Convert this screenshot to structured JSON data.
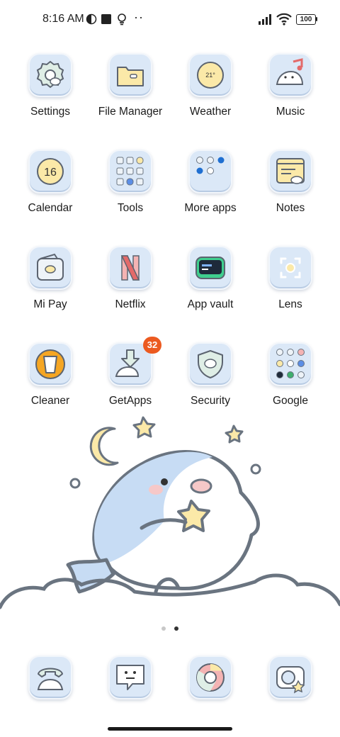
{
  "status_bar": {
    "time": "8:16 AM",
    "battery": "100",
    "more": "··"
  },
  "apps": [
    {
      "label": "Settings",
      "icon": "gear-icon"
    },
    {
      "label": "File Manager",
      "icon": "folder-icon"
    },
    {
      "label": "Weather",
      "icon": "weather-icon",
      "temp": "21°"
    },
    {
      "label": "Music",
      "icon": "music-note-icon"
    },
    {
      "label": "Calendar",
      "icon": "calendar-icon",
      "day": "16"
    },
    {
      "label": "Tools",
      "icon": "folder-tools-icon"
    },
    {
      "label": "More apps",
      "icon": "folder-more-apps-icon"
    },
    {
      "label": "Notes",
      "icon": "notes-icon"
    },
    {
      "label": "Mi Pay",
      "icon": "wallet-icon"
    },
    {
      "label": "Netflix",
      "icon": "netflix-icon"
    },
    {
      "label": "App vault",
      "icon": "app-vault-icon"
    },
    {
      "label": "Lens",
      "icon": "lens-icon"
    },
    {
      "label": "Cleaner",
      "icon": "trash-icon"
    },
    {
      "label": "GetApps",
      "icon": "download-icon",
      "badge": "32"
    },
    {
      "label": "Security",
      "icon": "shield-icon"
    },
    {
      "label": "Google",
      "icon": "folder-google-icon"
    }
  ],
  "dock": [
    {
      "icon": "phone-icon"
    },
    {
      "icon": "messages-icon"
    },
    {
      "icon": "chrome-icon"
    },
    {
      "icon": "camera-icon"
    }
  ],
  "colors": {
    "icon_bg": "#dbe8f7",
    "badge": "#ec5a20",
    "cream": "#fbe9a8",
    "outline": "#5c6470"
  }
}
